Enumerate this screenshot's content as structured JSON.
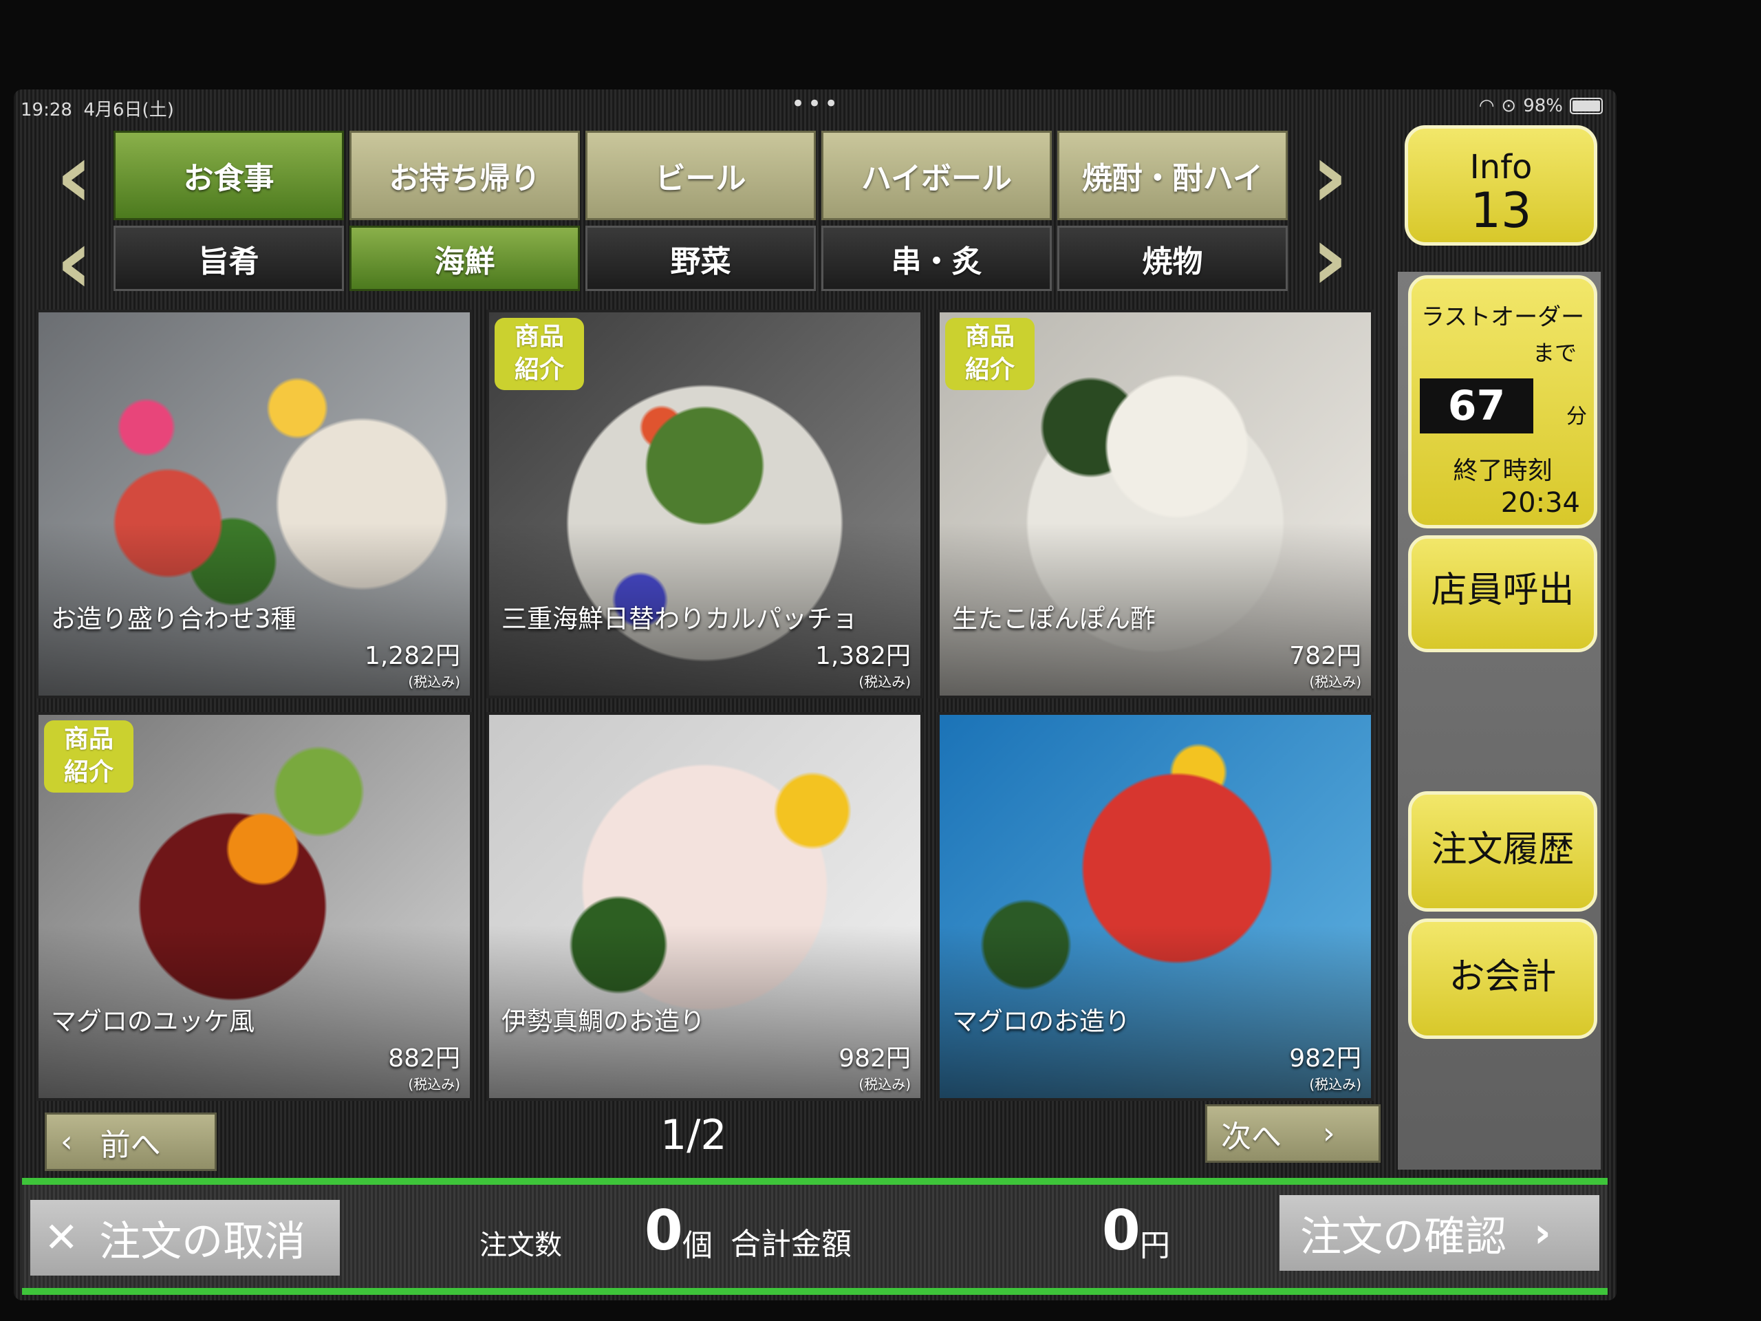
{
  "status": {
    "time": "19:28",
    "date": "4月6日(土)",
    "battery": "98%"
  },
  "categories": [
    {
      "label": "お食事",
      "active": true
    },
    {
      "label": "お持ち帰り",
      "active": false
    },
    {
      "label": "ビール",
      "active": false
    },
    {
      "label": "ハイボール",
      "active": false
    },
    {
      "label": "焼酎・酎ハイ",
      "active": false
    }
  ],
  "subcategories": [
    {
      "label": "旨肴",
      "active": false
    },
    {
      "label": "海鮮",
      "active": true
    },
    {
      "label": "野菜",
      "active": false
    },
    {
      "label": "串・炙",
      "active": false
    },
    {
      "label": "焼物",
      "active": false
    }
  ],
  "items": [
    {
      "name": "お造り盛り合わせ3種",
      "price": "1,282円",
      "tax": "(税込み)",
      "badge": ""
    },
    {
      "name": "三重海鮮日替わりカルパッチョ",
      "price": "1,382円",
      "tax": "(税込み)",
      "badge": "商品\n紹介"
    },
    {
      "name": "生たこぽんぽん酢",
      "price": "782円",
      "tax": "(税込み)",
      "badge": "商品\n紹介"
    },
    {
      "name": "マグロのユッケ風",
      "price": "882円",
      "tax": "(税込み)",
      "badge": "商品\n紹介"
    },
    {
      "name": "伊勢真鯛のお造り",
      "price": "982円",
      "tax": "(税込み)",
      "badge": ""
    },
    {
      "name": "マグロのお造り",
      "price": "982円",
      "tax": "(税込み)",
      "badge": ""
    }
  ],
  "pagination": {
    "prev": "前へ",
    "next": "次へ",
    "page": "1/2"
  },
  "sidebar": {
    "info_label": "Info",
    "info_count": "13",
    "last_order_label": "ラストオーダー",
    "last_order_made": "まで",
    "last_order_minutes": "67",
    "minutes_unit": "分",
    "end_time_label": "終了時刻",
    "end_time": "20:34",
    "call_staff": "店員呼出",
    "order_history": "注文履歴",
    "checkout": "お会計"
  },
  "footer": {
    "cancel": "注文の取消",
    "order_count_label": "注文数",
    "order_count": "0",
    "count_unit": "個",
    "total_label": "合計金額",
    "total": "0",
    "total_unit": "円",
    "confirm": "注文の確認"
  },
  "colors": {
    "accent_green": "#4c7a1e",
    "yellow": "#d8c82a",
    "footer_line": "#3ec43a"
  }
}
